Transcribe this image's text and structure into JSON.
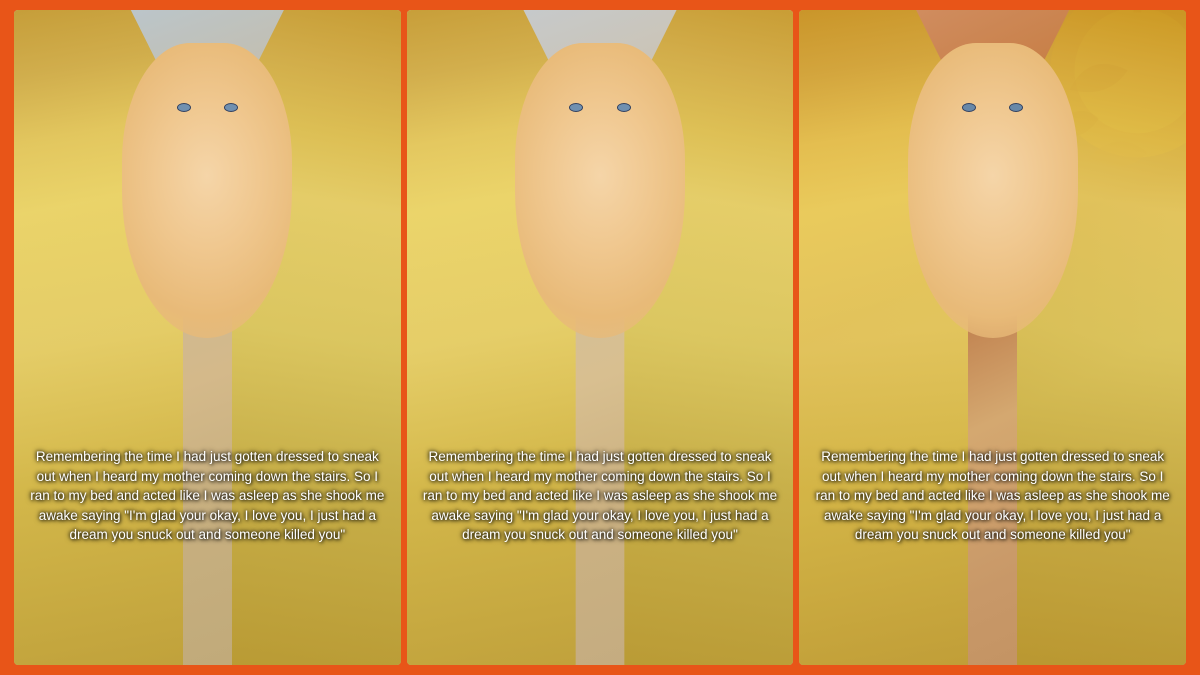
{
  "background_color": "#e85518",
  "panels": [
    {
      "id": "panel-1",
      "caption_text": "Remembering the time I had just gotten dressed to sneak out when I heard my mother coming down the stairs. So I ran to my bed and acted like I was asleep as she shook me awake saying \"I'm glad your okay, I love you, I just had a dream you snuck out and someone killed you\""
    },
    {
      "id": "panel-2",
      "caption_text": "Remembering the time I had just gotten dressed to sneak out when I heard my mother coming down the stairs. So I ran to my bed and acted like I was asleep as she shook me awake saying \"I'm glad your okay, I love you, I just had a dream you snuck out and someone killed you\""
    },
    {
      "id": "panel-3",
      "caption_text": "Remembering the time I had just gotten dressed to sneak out when I heard my mother coming down the stairs. So I ran to my bed and acted like I was asleep as she shook me awake saying \"I'm glad your okay, I love you, I just had a dream you snuck out and someone killed you\""
    }
  ]
}
